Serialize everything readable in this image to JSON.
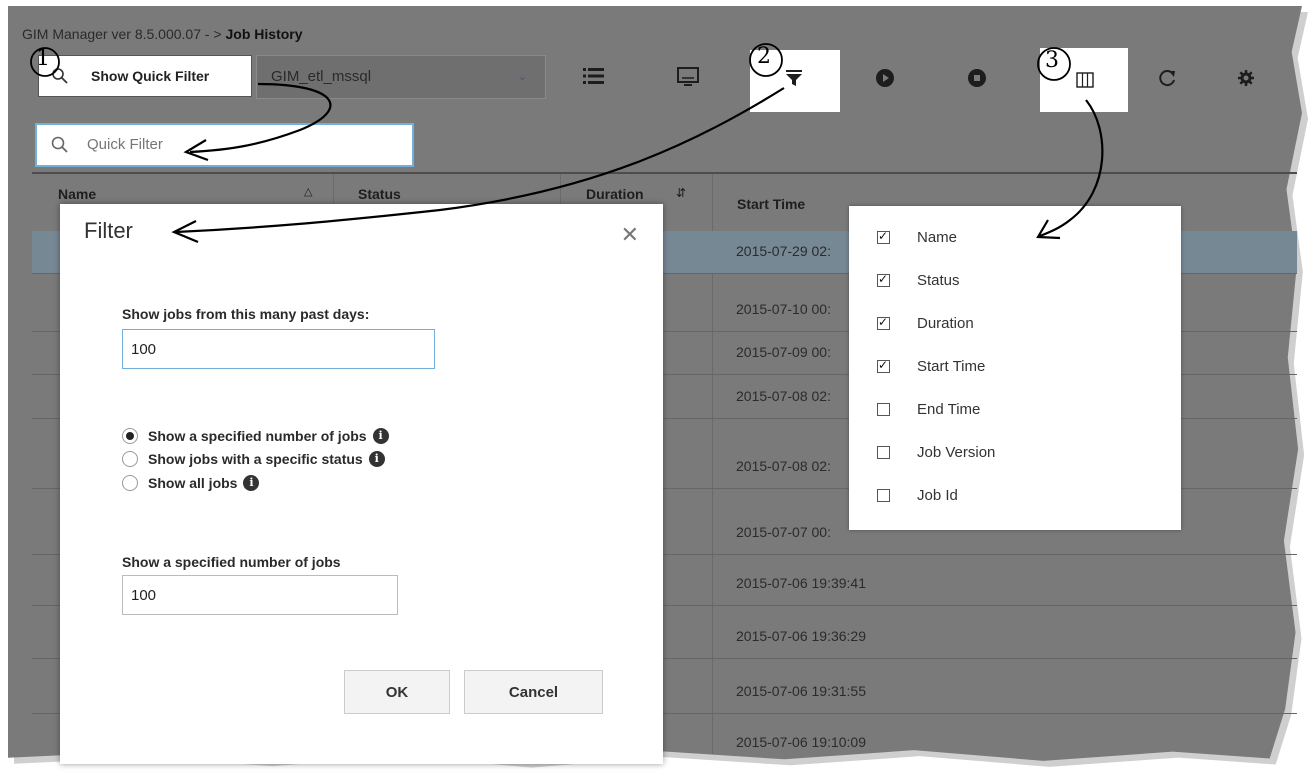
{
  "breadcrumb": {
    "prefix": "GIM Manager ver 8.5.000.07 -  >  ",
    "current": "Job History"
  },
  "toolbar": {
    "quick_filter_label": "Show Quick Filter",
    "job_select_value": "GIM_etl_mssql",
    "icons": [
      "list-icon",
      "monitor-icon",
      "filter-icon",
      "play-icon",
      "stop-icon",
      "columns-icon",
      "refresh-icon",
      "settings-icon"
    ]
  },
  "quick_filter": {
    "placeholder": "Quick Filter"
  },
  "table": {
    "columns": [
      "Name",
      "Status",
      "Duration",
      "Start Time"
    ],
    "rows": [
      {
        "start": "2015-07-29 02:",
        "selected": true
      },
      {
        "start": "2015-07-10 00:"
      },
      {
        "start": "2015-07-09 00:"
      },
      {
        "start": "2015-07-08 02:"
      },
      {
        "start": "2015-07-08 02:"
      },
      {
        "start": "2015-07-07 00:"
      },
      {
        "start": "2015-07-06 19:39:41"
      },
      {
        "start": "2015-07-06 19:36:29"
      },
      {
        "start": "2015-07-06 19:31:55"
      },
      {
        "start": "2015-07-06 19:10:09"
      }
    ]
  },
  "filter_dialog": {
    "title": "Filter",
    "past_days_label": "Show jobs from this many past days:",
    "past_days_value": "100",
    "radio_options": [
      {
        "label": "Show a specified number of jobs",
        "selected": true
      },
      {
        "label": "Show jobs with a specific status",
        "selected": false
      },
      {
        "label": "Show all jobs",
        "selected": false
      }
    ],
    "count_label": "Show a specified number of jobs",
    "count_value": "100",
    "ok_label": "OK",
    "cancel_label": "Cancel"
  },
  "column_menu": {
    "items": [
      {
        "label": "Name",
        "checked": true
      },
      {
        "label": "Status",
        "checked": true
      },
      {
        "label": "Duration",
        "checked": true
      },
      {
        "label": "Start Time",
        "checked": true
      },
      {
        "label": "End Time",
        "checked": false
      },
      {
        "label": "Job Version",
        "checked": false
      },
      {
        "label": "Job Id",
        "checked": false
      }
    ]
  },
  "callouts": [
    "1",
    "2",
    "3"
  ]
}
